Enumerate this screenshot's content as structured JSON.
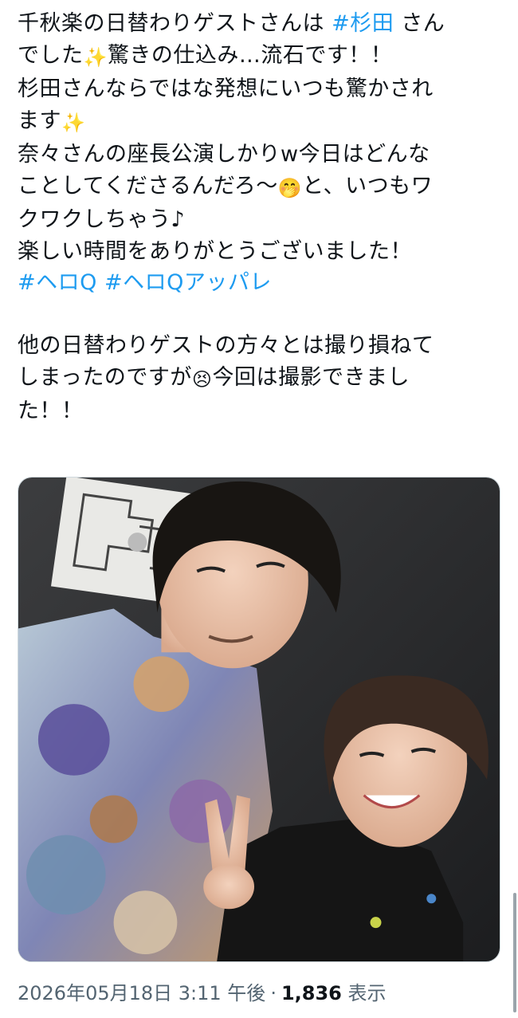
{
  "tweet": {
    "lines": [
      {
        "parts": [
          {
            "t": "千秋楽の日替わりゲストさんは "
          },
          {
            "t": "#杉田",
            "tag": true
          },
          {
            "t": " さん"
          }
        ]
      },
      {
        "parts": [
          {
            "t": "でした"
          },
          {
            "t": "✨",
            "emoji": "sparkles"
          },
          {
            "t": "驚きの仕込み…流石です！！"
          }
        ]
      },
      {
        "parts": [
          {
            "t": "杉田さんならではな発想にいつも驚かされ"
          }
        ]
      },
      {
        "parts": [
          {
            "t": "ます"
          },
          {
            "t": "✨",
            "emoji": "sparkles"
          }
        ]
      },
      {
        "parts": [
          {
            "t": "奈々さんの座長公演しかりw今日はどんな"
          }
        ]
      },
      {
        "parts": [
          {
            "t": "ことしてくださるんだろ〜"
          },
          {
            "t": "🤭",
            "emoji": "hand-over-mouth"
          },
          {
            "t": "と、いつもワ"
          }
        ]
      },
      {
        "parts": [
          {
            "t": "クワクしちゃう♪"
          }
        ]
      },
      {
        "parts": [
          {
            "t": "楽しい時間をありがとうございました！"
          }
        ]
      },
      {
        "parts": [
          {
            "t": "#ヘロQ",
            "tag": true
          },
          {
            "t": " "
          },
          {
            "t": "#ヘロQアッパレ",
            "tag": true
          }
        ]
      },
      {
        "blank": true
      },
      {
        "parts": [
          {
            "t": "他の日替わりゲストの方々とは撮り損ねて"
          }
        ]
      },
      {
        "parts": [
          {
            "t": "しまったのですが"
          },
          {
            "t": "😣",
            "emoji": "persevering-face"
          },
          {
            "t": "今回は撮影できまし"
          }
        ]
      },
      {
        "parts": [
          {
            "t": "た！！"
          }
        ]
      }
    ],
    "accent_color": "#1d9bf0",
    "text_color": "#0f1419"
  },
  "photo": {
    "icon": "photo"
  },
  "meta": {
    "timestamp": "2026年05月18日 3:11 午後",
    "separator": "·",
    "view_count": "1,836",
    "view_label": "表示",
    "muted_color": "#536471"
  }
}
